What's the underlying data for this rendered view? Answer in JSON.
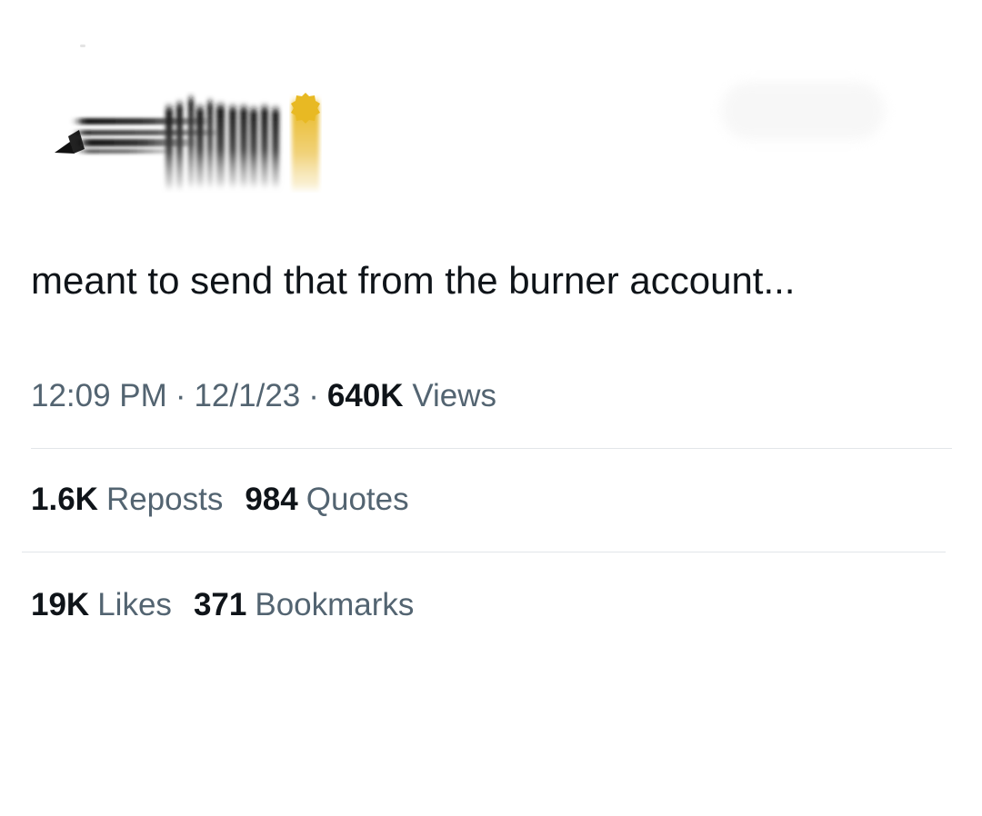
{
  "tweet": {
    "text": "meant to send that from the burner account...",
    "time": "12:09 PM",
    "date": "12/1/23",
    "views_count": "640K",
    "views_label": "Views",
    "separator": "·"
  },
  "stats": {
    "reposts": {
      "count": "1.6K",
      "label": "Reposts"
    },
    "quotes": {
      "count": "984",
      "label": "Quotes"
    },
    "likes": {
      "count": "19K",
      "label": "Likes"
    },
    "bookmarks": {
      "count": "371",
      "label": "Bookmarks"
    }
  },
  "header": {
    "logo_icon": "adidas-logo-icon",
    "verified_icon": "verified-badge-icon",
    "colors": {
      "badge_gold": "#e8b923",
      "text_primary": "#0f1419",
      "text_secondary": "#536471",
      "divider": "#e2e6e9"
    }
  }
}
